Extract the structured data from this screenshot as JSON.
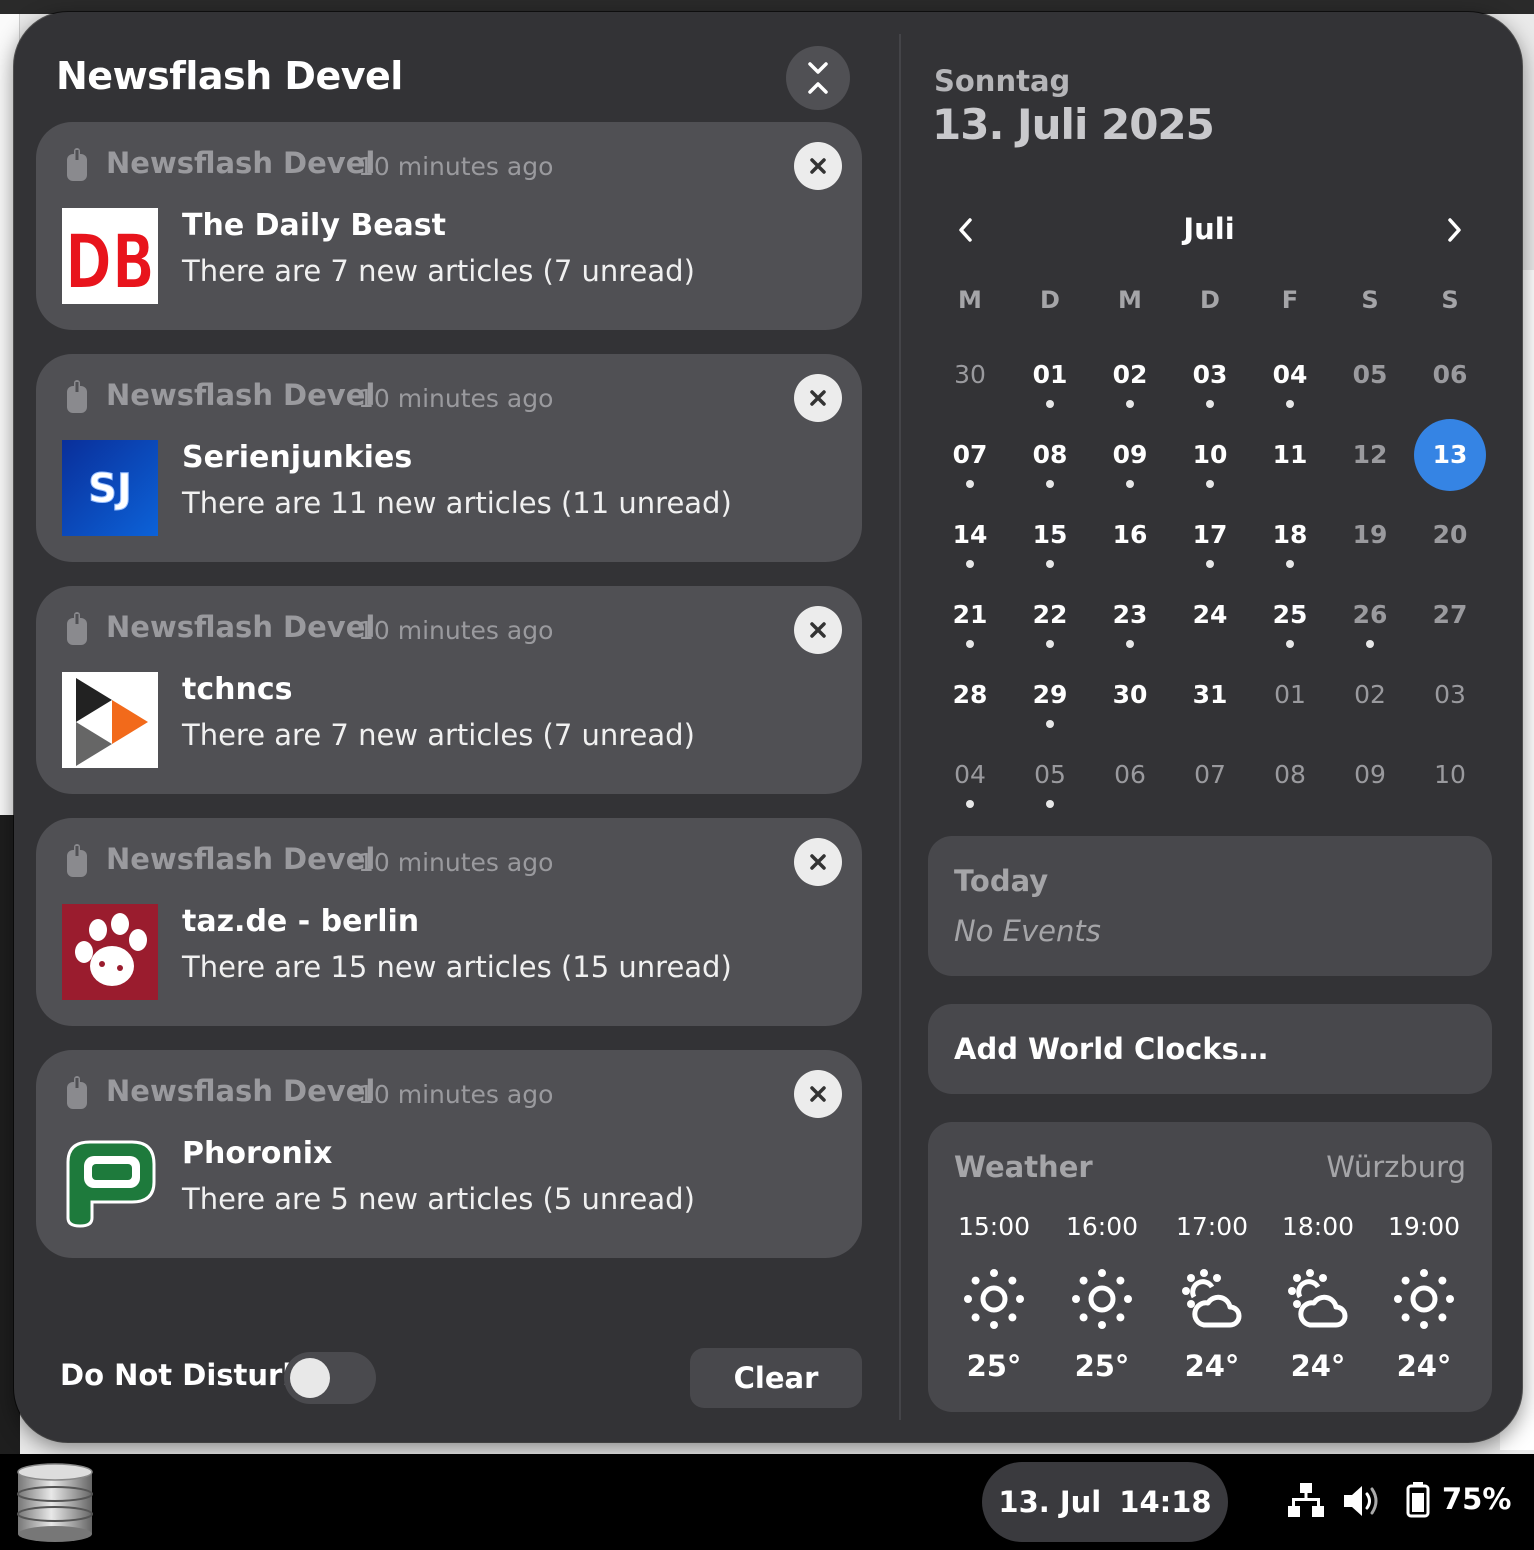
{
  "panel": {
    "title": "Newsflash Devel",
    "collapse_icon": "collapse-icon"
  },
  "notifications": [
    {
      "app": "Newsflash Devel",
      "time": "10 minutes ago",
      "title": "The Daily Beast",
      "body": "There are 7 new articles (7 unread)",
      "logo": "DB"
    },
    {
      "app": "Newsflash Devel",
      "time": "10 minutes ago",
      "title": "Serienjunkies",
      "body": "There are 11 new articles (11 unread)",
      "logo": "SJ"
    },
    {
      "app": "Newsflash Devel",
      "time": "10 minutes ago",
      "title": "tchncs",
      "body": "There are 7 new articles (7 unread)",
      "logo": "tchncs-logo"
    },
    {
      "app": "Newsflash Devel",
      "time": "10 minutes ago",
      "title": "taz.de - berlin",
      "body": "There are 15 new articles (15 unread)",
      "logo": "paw-logo"
    },
    {
      "app": "Newsflash Devel",
      "time": "10 minutes ago",
      "title": "Phoronix",
      "body": "There are 5 new articles (5 unread)",
      "logo": "phoronix-logo"
    }
  ],
  "footer": {
    "dnd_label": "Do Not Disturb",
    "dnd_on": false,
    "clear_label": "Clear"
  },
  "calendar": {
    "weekday": "Sonntag",
    "full_date": "13. Juli 2025",
    "month": "Juli",
    "headers": [
      "M",
      "D",
      "M",
      "D",
      "F",
      "S",
      "S"
    ],
    "weeks": [
      [
        {
          "d": "30",
          "t": "dim"
        },
        {
          "d": "01",
          "t": "bold",
          "e": true
        },
        {
          "d": "02",
          "t": "bold",
          "e": true
        },
        {
          "d": "03",
          "t": "bold",
          "e": true
        },
        {
          "d": "04",
          "t": "bold",
          "e": true
        },
        {
          "d": "05",
          "t": "weekend"
        },
        {
          "d": "06",
          "t": "weekend"
        }
      ],
      [
        {
          "d": "07",
          "t": "bold",
          "e": true
        },
        {
          "d": "08",
          "t": "bold",
          "e": true
        },
        {
          "d": "09",
          "t": "bold",
          "e": true
        },
        {
          "d": "10",
          "t": "bold",
          "e": true
        },
        {
          "d": "11",
          "t": "bold"
        },
        {
          "d": "12",
          "t": "weekend"
        },
        {
          "d": "13",
          "t": "today"
        }
      ],
      [
        {
          "d": "14",
          "t": "bold",
          "e": true
        },
        {
          "d": "15",
          "t": "bold",
          "e": true
        },
        {
          "d": "16",
          "t": "bold"
        },
        {
          "d": "17",
          "t": "bold",
          "e": true
        },
        {
          "d": "18",
          "t": "bold",
          "e": true
        },
        {
          "d": "19",
          "t": "weekend"
        },
        {
          "d": "20",
          "t": "weekend"
        }
      ],
      [
        {
          "d": "21",
          "t": "bold",
          "e": true
        },
        {
          "d": "22",
          "t": "bold",
          "e": true
        },
        {
          "d": "23",
          "t": "bold",
          "e": true
        },
        {
          "d": "24",
          "t": "bold"
        },
        {
          "d": "25",
          "t": "bold",
          "e": true
        },
        {
          "d": "26",
          "t": "weekend",
          "e": true
        },
        {
          "d": "27",
          "t": "weekend"
        }
      ],
      [
        {
          "d": "28",
          "t": "bold"
        },
        {
          "d": "29",
          "t": "bold",
          "e": true
        },
        {
          "d": "30",
          "t": "bold"
        },
        {
          "d": "31",
          "t": "bold"
        },
        {
          "d": "01",
          "t": "dim"
        },
        {
          "d": "02",
          "t": "dim"
        },
        {
          "d": "03",
          "t": "dim"
        }
      ],
      [
        {
          "d": "04",
          "t": "dim",
          "e": true
        },
        {
          "d": "05",
          "t": "dim",
          "e": true
        },
        {
          "d": "06",
          "t": "dim"
        },
        {
          "d": "07",
          "t": "dim"
        },
        {
          "d": "08",
          "t": "dim"
        },
        {
          "d": "09",
          "t": "dim"
        },
        {
          "d": "10",
          "t": "dim"
        }
      ]
    ]
  },
  "events": {
    "title": "Today",
    "empty": "No Events"
  },
  "world_clocks": {
    "label": "Add World Clocks…"
  },
  "weather": {
    "title": "Weather",
    "location": "Würzburg",
    "forecast": [
      {
        "time": "15:00",
        "icon": "sun-icon",
        "temp": "25°"
      },
      {
        "time": "16:00",
        "icon": "sun-icon",
        "temp": "25°"
      },
      {
        "time": "17:00",
        "icon": "partly-cloudy-icon",
        "temp": "24°"
      },
      {
        "time": "18:00",
        "icon": "partly-cloudy-icon",
        "temp": "24°"
      },
      {
        "time": "19:00",
        "icon": "sun-icon",
        "temp": "24°"
      }
    ]
  },
  "taskbar": {
    "date": "13. Jul",
    "time": "14:18",
    "battery": "75%"
  },
  "colors": {
    "accent": "#3584e4",
    "popover_bg": "#333336",
    "card_bg": "#505054"
  }
}
